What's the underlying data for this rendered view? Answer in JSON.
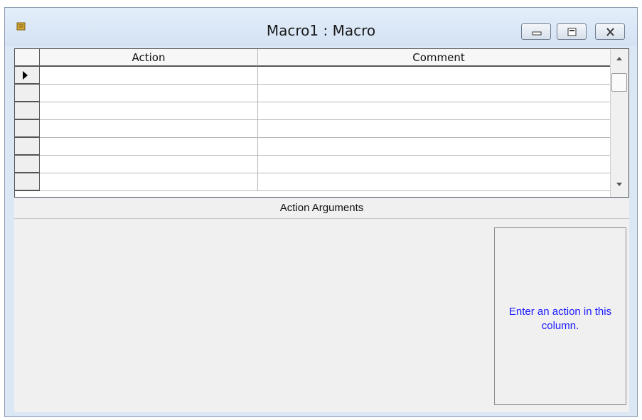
{
  "window": {
    "title": "Macro1 : Macro",
    "icon": "macro-scroll-icon",
    "controls": [
      "minimize-icon",
      "maximize-icon",
      "close-icon"
    ]
  },
  "grid": {
    "columns": [
      "Action",
      "Comment"
    ],
    "rows": [
      {
        "action": "",
        "comment": ""
      },
      {
        "action": "",
        "comment": ""
      },
      {
        "action": "",
        "comment": ""
      },
      {
        "action": "",
        "comment": ""
      },
      {
        "action": "",
        "comment": ""
      },
      {
        "action": "",
        "comment": ""
      },
      {
        "action": "",
        "comment": ""
      }
    ],
    "current_row_icon": "row-selector-arrow-icon"
  },
  "arguments": {
    "header": "Action Arguments",
    "help_text": "Enter an action in this column."
  },
  "colors": {
    "frame": "#dbe7f4",
    "help_text": "#1a1aff"
  }
}
